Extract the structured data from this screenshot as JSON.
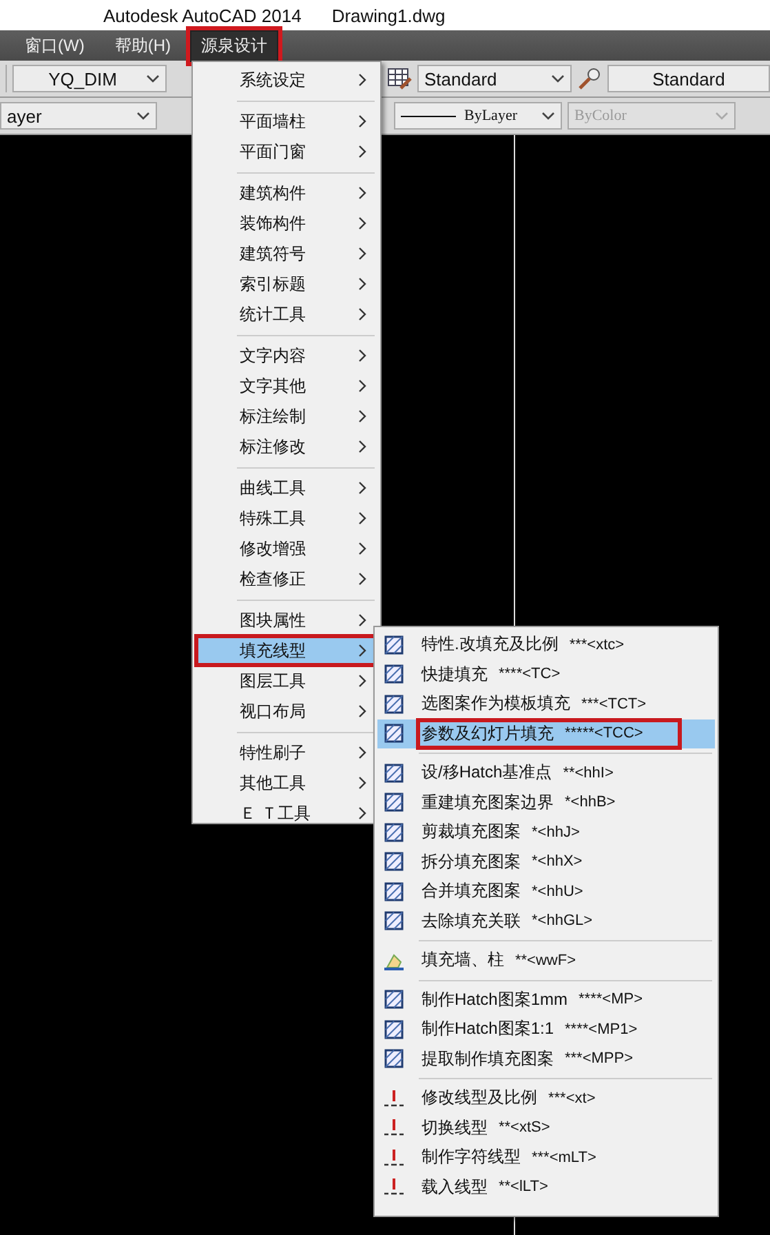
{
  "title_bar": {
    "app": "Autodesk AutoCAD 2014",
    "document": "Drawing1.dwg"
  },
  "menu_bar": [
    {
      "label": "窗口(W)",
      "selected": false,
      "annotated": false
    },
    {
      "label": "帮助(H)",
      "selected": false,
      "annotated": false
    },
    {
      "label": "源泉设计",
      "selected": true,
      "annotated": true
    }
  ],
  "toolbar_1": {
    "dim_style": "YQ_DIM",
    "table_style": "Standard",
    "multileader_style": "Standard"
  },
  "toolbar_2": {
    "layer": "ayer",
    "linetype": "ByLayer",
    "plot_style": "ByColor",
    "plot_style_disabled": true
  },
  "menu": [
    [
      {
        "label": "系统设定",
        "selected": false,
        "annotated": false
      }
    ],
    [
      {
        "label": "平面墙柱",
        "selected": false,
        "annotated": false
      },
      {
        "label": "平面门窗",
        "selected": false,
        "annotated": false
      }
    ],
    [
      {
        "label": "建筑构件",
        "selected": false,
        "annotated": false
      },
      {
        "label": "装饰构件",
        "selected": false,
        "annotated": false
      },
      {
        "label": "建筑符号",
        "selected": false,
        "annotated": false
      },
      {
        "label": "索引标题",
        "selected": false,
        "annotated": false
      },
      {
        "label": "统计工具",
        "selected": false,
        "annotated": false
      }
    ],
    [
      {
        "label": "文字内容",
        "selected": false,
        "annotated": false
      },
      {
        "label": "文字其他",
        "selected": false,
        "annotated": false
      },
      {
        "label": "标注绘制",
        "selected": false,
        "annotated": false
      },
      {
        "label": "标注修改",
        "selected": false,
        "annotated": false
      }
    ],
    [
      {
        "label": "曲线工具",
        "selected": false,
        "annotated": false
      },
      {
        "label": "特殊工具",
        "selected": false,
        "annotated": false
      },
      {
        "label": "修改增强",
        "selected": false,
        "annotated": false
      },
      {
        "label": "检查修正",
        "selected": false,
        "annotated": false
      }
    ],
    [
      {
        "label": "图块属性",
        "selected": false,
        "annotated": false
      },
      {
        "label": "填充线型",
        "selected": true,
        "annotated": true
      },
      {
        "label": "图层工具",
        "selected": false,
        "annotated": false
      },
      {
        "label": "视口布局",
        "selected": false,
        "annotated": false
      }
    ],
    [
      {
        "label": "特性刷子",
        "selected": false,
        "annotated": false
      },
      {
        "label": "其他工具",
        "selected": false,
        "annotated": false
      },
      {
        "label": "Ｅ Ｔ工具",
        "selected": false,
        "annotated": false
      }
    ]
  ],
  "submenu": [
    [
      {
        "label": "特性.改填充及比例",
        "shortcut": "***<xtc>",
        "selected": false,
        "annotated": false
      },
      {
        "label": "快捷填充",
        "shortcut": "****<TC>",
        "selected": false,
        "annotated": false
      },
      {
        "label": "选图案作为模板填充",
        "shortcut": "***<TCT>",
        "selected": false,
        "annotated": false
      },
      {
        "label": "参数及幻灯片填充",
        "shortcut": "*****<TCC>",
        "selected": true,
        "annotated": true
      }
    ],
    [
      {
        "label": "设/移Hatch基准点",
        "shortcut": "**<hhI>",
        "selected": false,
        "annotated": false
      },
      {
        "label": "重建填充图案边界",
        "shortcut": "*<hhB>",
        "selected": false,
        "annotated": false
      },
      {
        "label": "剪裁填充图案",
        "shortcut": "*<hhJ>",
        "selected": false,
        "annotated": false
      },
      {
        "label": "拆分填充图案",
        "shortcut": "*<hhX>",
        "selected": false,
        "annotated": false
      },
      {
        "label": "合并填充图案",
        "shortcut": "*<hhU>",
        "selected": false,
        "annotated": false
      },
      {
        "label": "去除填充关联",
        "shortcut": "*<hhGL>",
        "selected": false,
        "annotated": false
      }
    ],
    [
      {
        "label": "填充墙、柱",
        "shortcut": "**<wwF>",
        "selected": false,
        "annotated": false
      }
    ],
    [
      {
        "label": "制作Hatch图案1mm",
        "shortcut": "****<MP>",
        "selected": false,
        "annotated": false
      },
      {
        "label": "制作Hatch图案1:1",
        "shortcut": "****<MP1>",
        "selected": false,
        "annotated": false
      },
      {
        "label": "提取制作填充图案",
        "shortcut": "***<MPP>",
        "selected": false,
        "annotated": false
      }
    ],
    [
      {
        "label": "修改线型及比例",
        "shortcut": "***<xt>",
        "selected": false,
        "annotated": false
      },
      {
        "label": "切换线型",
        "shortcut": "**<xtS>",
        "selected": false,
        "annotated": false
      },
      {
        "label": "制作字符线型",
        "shortcut": "***<mLT>",
        "selected": false,
        "annotated": false
      },
      {
        "label": "载入线型",
        "shortcut": "**<lLT>",
        "selected": false,
        "annotated": false
      }
    ]
  ]
}
